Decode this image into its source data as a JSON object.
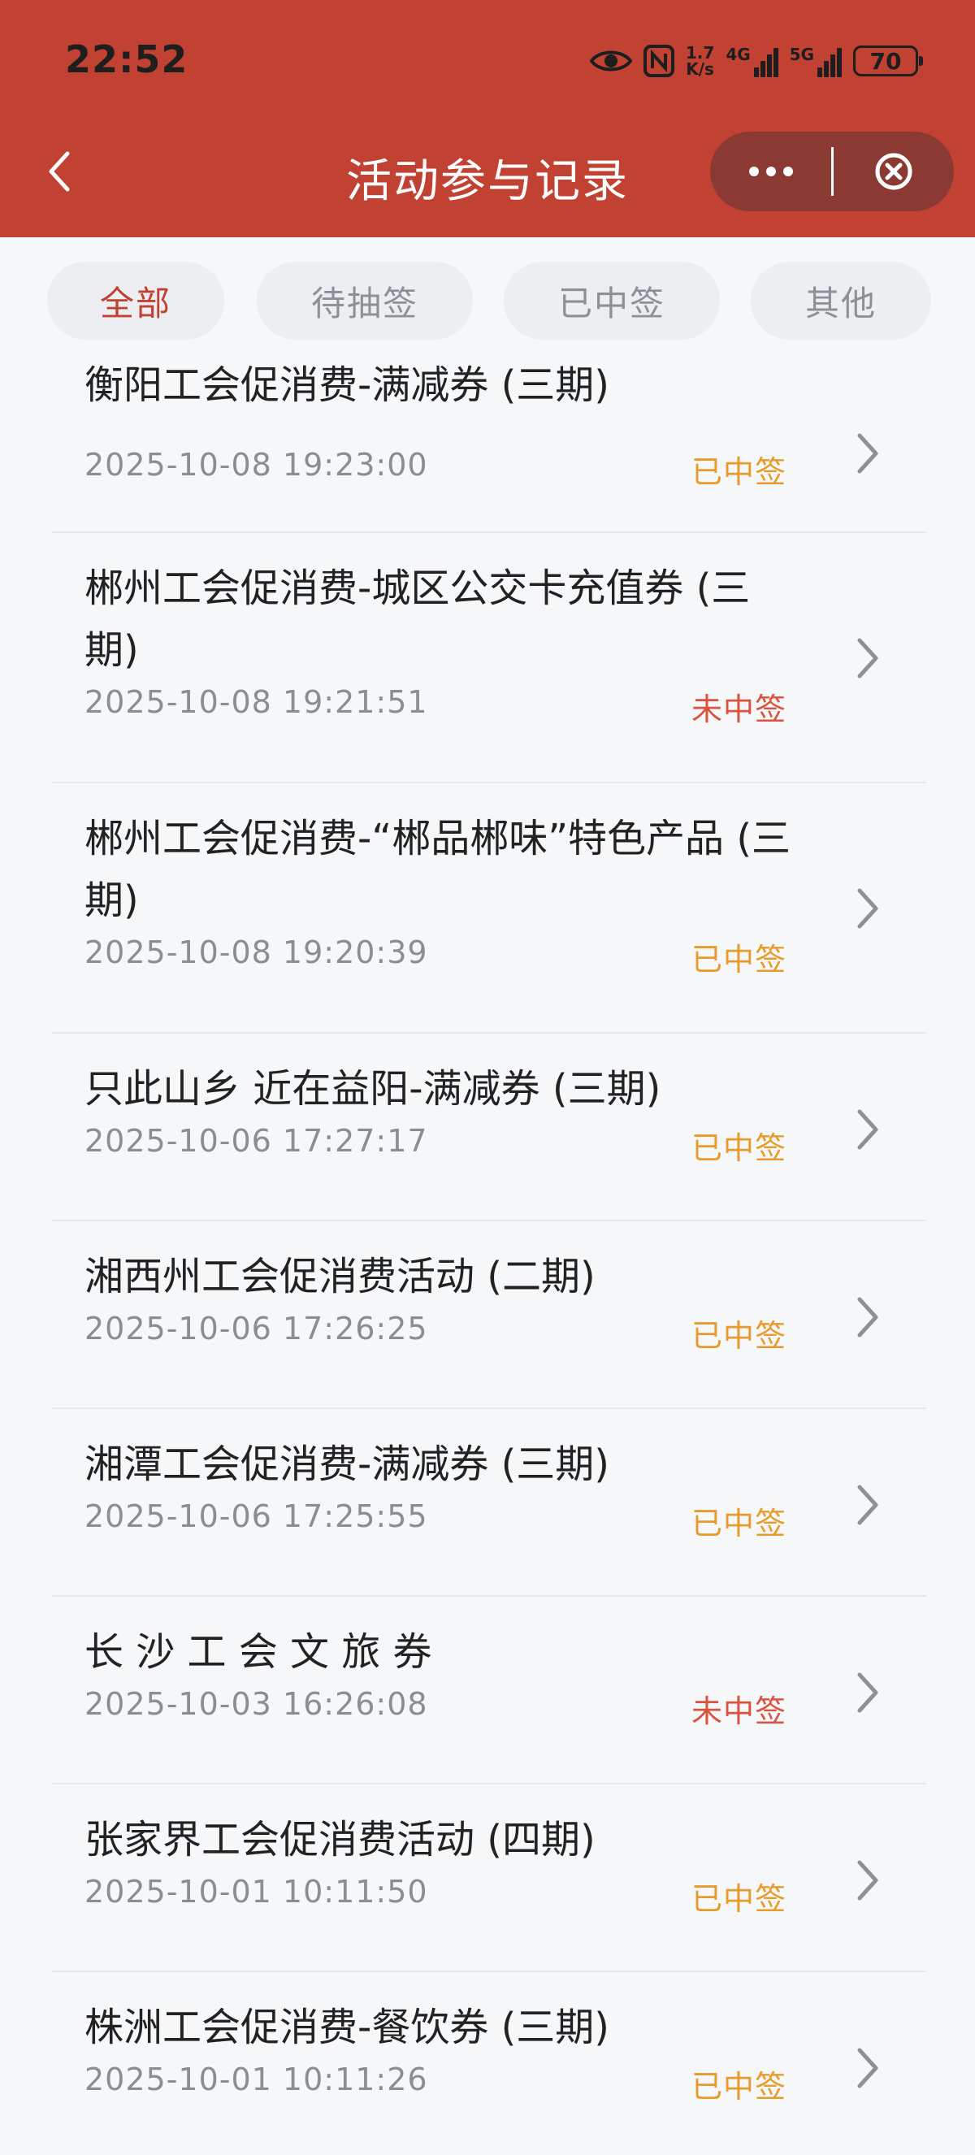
{
  "status_bar": {
    "time": "22:52",
    "net_speed_value": "1.7",
    "net_speed_unit": "K/s",
    "signal_1_label": "4G",
    "signal_2_label": "5G",
    "battery": "70",
    "icons": [
      "eye-icon",
      "nfc-icon",
      "signal-icon",
      "signal-icon",
      "battery-icon"
    ]
  },
  "header": {
    "title": "活动参与记录",
    "back_icon": "chevron-left-icon",
    "more_icon": "more-dots-icon",
    "close_icon": "close-circle-icon",
    "background_color": "#c14132"
  },
  "tabs": [
    {
      "label": "全部",
      "active": true
    },
    {
      "label": "待抽签",
      "active": false
    },
    {
      "label": "已中签",
      "active": false
    },
    {
      "label": "其他",
      "active": false
    }
  ],
  "colors": {
    "won": "#e79a2d",
    "lost": "#d9533e",
    "accent": "#c14132"
  },
  "records": [
    {
      "title": "衡阳工会促消费-满减券 (三期)",
      "date": "2025-10-08 19:23:00",
      "status": "已中签"
    },
    {
      "title": "郴州工会促消费-城区公交卡充值券 (三期)",
      "date": "2025-10-08 19:21:51",
      "status": "未中签"
    },
    {
      "title": "郴州工会促消费-“郴品郴味”特色产品 (三期)",
      "date": "2025-10-08 19:20:39",
      "status": "已中签"
    },
    {
      "title": "只此山乡 近在益阳-满减券 (三期)",
      "date": "2025-10-06 17:27:17",
      "status": "已中签"
    },
    {
      "title": "湘西州工会促消费活动 (二期)",
      "date": "2025-10-06 17:26:25",
      "status": "已中签"
    },
    {
      "title": "湘潭工会促消费-满减券 (三期)",
      "date": "2025-10-06 17:25:55",
      "status": "已中签"
    },
    {
      "title": "长 沙 工 会 文 旅 券",
      "date": "2025-10-03 16:26:08",
      "status": "未中签"
    },
    {
      "title": "张家界工会促消费活动 (四期)",
      "date": "2025-10-01 10:11:50",
      "status": "已中签"
    },
    {
      "title": "株洲工会促消费-餐饮券 (三期)",
      "date": "2025-10-01 10:11:26",
      "status": "已中签"
    }
  ]
}
